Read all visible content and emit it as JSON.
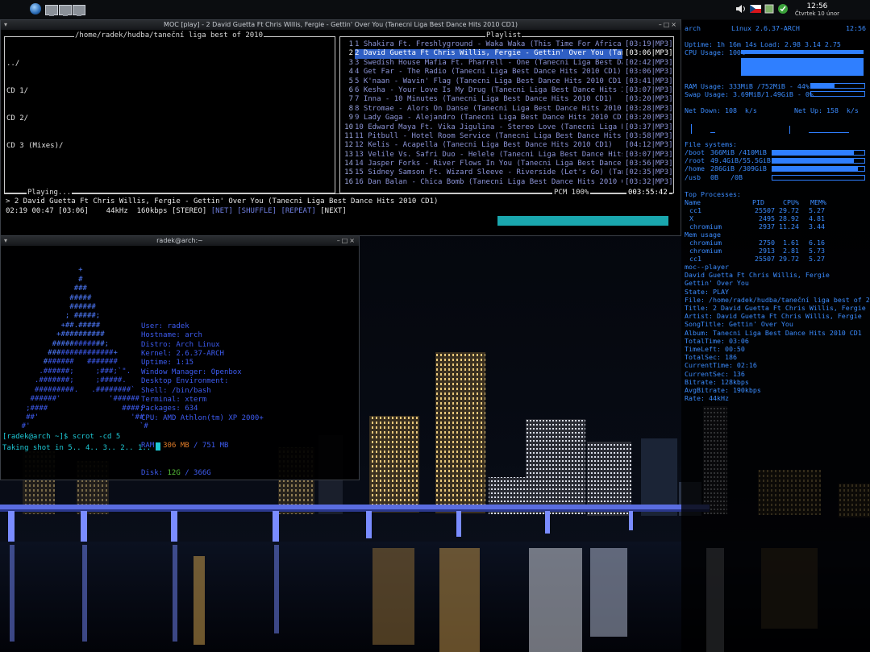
{
  "colors": {
    "accent": "#3b8cff",
    "playlist_text": "#8b93d6",
    "highlight": "#2f5fc4",
    "volume": "#1aa7ae",
    "prompt": "#1ec8d6"
  },
  "panel": {
    "icons": [
      "arch-logo-icon",
      "desktop-1-icon",
      "desktop-2-icon",
      "desktop-3-icon"
    ],
    "clock_time": "12:56",
    "clock_date": "Čtvrtek 10 únor"
  },
  "moc": {
    "title": "MOC [play] - 2 David Guetta Ft Chris Willis, Fergie - Gettin' Over You (Tanecni Liga Best Dance Hits 2010 CD1)",
    "dir_path": "/home/radek/hudba/taneční liga best of 2010",
    "dir_entries": [
      "../",
      "CD 1/",
      "CD 2/",
      "CD 3 (Mixes)/"
    ],
    "playlist_label": "Playlist",
    "playlist": [
      {
        "n": "1",
        "title": "1 Shakira Ft. Freshlyground - Waka Waka (This Time For Africa)",
        "time": "[03:19|MP3]"
      },
      {
        "n": "2",
        "title": "2 David Guetta Ft Chris Willis, Fergie - Gettin' Over You (Tan",
        "time": "[03:06|MP3]"
      },
      {
        "n": "3",
        "title": "3 Swedish House Mafia Ft. Pharrell - One (Tanecni Liga Best Da",
        "time": "[02:42|MP3]"
      },
      {
        "n": "4",
        "title": "4 Get Far - The Radio (Tanecni Liga Best Dance Hits 2010 CD1)",
        "time": "[03:06|MP3]"
      },
      {
        "n": "5",
        "title": "5 K'naan - Wavin' Flag (Tanecni Liga Best Dance Hits 2010 CD1)",
        "time": "[03:41|MP3]"
      },
      {
        "n": "6",
        "title": "6 Kesha - Your Love Is My Drug (Tanecni Liga Best Dance Hits 2",
        "time": "[03:07|MP3]"
      },
      {
        "n": "7",
        "title": "7 Inna - 10 Minutes (Tanecni Liga Best Dance Hits 2010 CD1)",
        "time": "[03:20|MP3]"
      },
      {
        "n": "8",
        "title": "8 Stromae - Alors On Danse (Tanecni Liga Best Dance Hits 2010",
        "time": "[03:28|MP3]"
      },
      {
        "n": "9",
        "title": "9 Lady Gaga - Alejandro (Tanecni Liga Best Dance Hits 2010 CD1",
        "time": "[03:20|MP3]"
      },
      {
        "n": "10",
        "title": "10 Edward Maya Ft. Vika Jigulina - Stereo Love (Tanecni Liga B",
        "time": "[03:37|MP3]"
      },
      {
        "n": "11",
        "title": "11 Pitbull - Hotel Room Service (Tanecni Liga Best Dance Hits",
        "time": "[03:58|MP3]"
      },
      {
        "n": "12",
        "title": "12 Kelis - Acapella (Tanecni Liga Best Dance Hits 2010 CD1)",
        "time": "[04:12|MP3]"
      },
      {
        "n": "13",
        "title": "13 Velile Vs. Safri Duo - Helele (Tanecni Liga Best Dance Hits",
        "time": "[03:07|MP3]"
      },
      {
        "n": "14",
        "title": "14 Jasper Forks - River Flows In You (Tanecni Liga Best Dance",
        "time": "[03:56|MP3]"
      },
      {
        "n": "15",
        "title": "15 Sidney Samson Ft. Wizard Sleeve - Riverside (Let's Go) (Tan",
        "time": "[02:35|MP3]"
      },
      {
        "n": "16",
        "title": "16 Dan Balan - Chica Bomb (Tanecni Liga Best Dance Hits 2010 C",
        "time": "[03:32|MP3]"
      }
    ],
    "playing_label": "Playing...",
    "now_playing": "> 2 David Guetta Ft Chris Willis, Fergie - Gettin' Over You (Tanecni Liga Best Dance Hits 2010 CD1)",
    "pcm": "PCM 100%",
    "total_time": "003:55:42",
    "status": {
      "elapsed": "02:19",
      "left": "00:47",
      "total": "[03:06]",
      "freq": "44kHz",
      "bitrate": "160kbps",
      "stereo": "[STEREO]",
      "net": "[NET]",
      "shuffle": "[SHUFFLE]",
      "repeat": "[REPEAT]",
      "next": "[NEXT]"
    },
    "volume_fraction": 1.0
  },
  "xterm": {
    "title": "radek@arch:~",
    "info": [
      {
        "k": "User:",
        "v": "radek"
      },
      {
        "k": "Hostname:",
        "v": "arch"
      },
      {
        "k": "Distro:",
        "v": "Arch Linux"
      },
      {
        "k": "Kernel:",
        "v": "2.6.37-ARCH"
      },
      {
        "k": "Uptime:",
        "v": "1:15"
      },
      {
        "k": "Window Manager:",
        "v": "Openbox"
      },
      {
        "k": "Desktop Environment:",
        "v": ""
      },
      {
        "k": "Shell:",
        "v": "/bin/bash"
      },
      {
        "k": "Terminal:",
        "v": "xterm"
      },
      {
        "k": "Packages:",
        "v": "634"
      },
      {
        "k": "CPU:",
        "v": "AMD Athlon(tm) XP 2000+"
      }
    ],
    "ram_label": "RAM:",
    "ram_used": "306 MB",
    "ram_sep": " / ",
    "ram_total": "751 MB",
    "disk_label": "Disk:",
    "disk_used": "12G",
    "disk_sep": " / ",
    "disk_total": "366G",
    "prompt": "[radek@arch ~]$ scrot -cd 5",
    "countdown": "Taking shot in 5.. 4.. 3.. 2.. 1.. "
  },
  "conky": {
    "host": "arch",
    "kernel": "Linux 2.6.37-ARCH",
    "time": "12:56",
    "uptime": "Uptime: 1h 16m 14s",
    "load": "Load: 2.98 3.14 2.75",
    "cpu_usage": "CPU Usage: 100%",
    "cpu_fraction": 1.0,
    "ram_usage": "RAM Usage: 333MiB /752MiB - 44%",
    "ram_fraction": 0.44,
    "swap_usage": "Swap Usage: 3.69MiB/1.49GiB - 0%",
    "swap_fraction": 0.0,
    "net_down": "Net Down: 108  k/s",
    "net_up": "Net Up: 158  k/s",
    "fs_header": "File systems:",
    "fs": [
      {
        "name": "/boot",
        "size": "366MiB /410MiB",
        "fraction": 0.89
      },
      {
        "name": "/root",
        "size": "49.4GiB/55.5GiB",
        "fraction": 0.89
      },
      {
        "name": "/home",
        "size": "286GiB /309GiB",
        "fraction": 0.93
      },
      {
        "name": "/usb",
        "size": "0B   /0B",
        "fraction": 0.0
      }
    ],
    "top_header": "Top Processes:",
    "top_cols": [
      "Name",
      "PID",
      "CPU%",
      "MEM%"
    ],
    "top": [
      {
        "name": "cc1",
        "pid": "25507",
        "cpu": "29.72",
        "mem": "5.27"
      },
      {
        "name": "X",
        "pid": "2495",
        "cpu": "28.92",
        "mem": "4.81"
      },
      {
        "name": "chromium",
        "pid": "2937",
        "cpu": "11.24",
        "mem": "3.44"
      }
    ],
    "mem_header": "Mem usage",
    "mem": [
      {
        "name": "chromium",
        "pid": "2750",
        "cpu": "1.61",
        "mem": "6.16"
      },
      {
        "name": "chromium",
        "pid": "2913",
        "cpu": "2.81",
        "mem": "5.73"
      },
      {
        "name": "cc1",
        "pid": "25507",
        "cpu": "29.72",
        "mem": "5.27"
      }
    ],
    "moc_lines": [
      "moc--player",
      "David Guetta Ft Chris Willis, Fergie",
      "Gettin' Over You",
      "State: PLAY",
      "File: /home/radek/hudba/taneční liga best of 20",
      "Title: 2 David Guetta Ft Chris Willis, Fergie -",
      "Artist: David Guetta Ft Chris Willis, Fergie",
      "SongTitle: Gettin' Over You",
      "Album: Tanecni Liga Best Dance Hits 2010 CD1",
      "TotalTime: 03:06",
      "TimeLeft: 00:50",
      "TotalSec: 186",
      "CurrentTime: 02:16",
      "CurrentSec: 136",
      "Bitrate: 128kbps",
      "AvgBitrate: 190kbps",
      "Rate: 44kHz"
    ]
  }
}
